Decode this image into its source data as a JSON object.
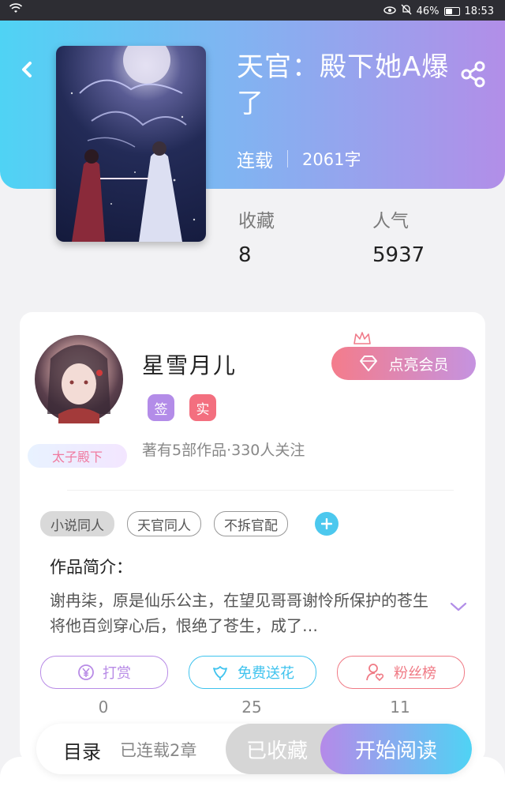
{
  "status_bar": {
    "battery": "46%",
    "battery_level": 0.46,
    "time": "18:53"
  },
  "book": {
    "title": "天官：殿下她A爆了",
    "status": "连载",
    "word_count": "2061字",
    "collect_label": "收藏",
    "collect_value": "8",
    "popularity_label": "人气",
    "popularity_value": "5937"
  },
  "author": {
    "name": "星雪月儿",
    "badges": [
      "签",
      "实"
    ],
    "badge_colors": [
      "#b38ce8",
      "#f36f7f"
    ],
    "title_badge": "太子殿下",
    "stats": "著有5部作品·330人关注",
    "vip_button": "点亮会员"
  },
  "tags": [
    "小说同人",
    "天官同人",
    "不拆官配"
  ],
  "intro": {
    "title": "作品简介：",
    "text": "谢冉柒，原是仙乐公主，在望见哥哥谢怜所保护的苍生将他百剑穿心后，恨绝了苍生，成了…"
  },
  "actions": [
    {
      "label": "打赏",
      "count": "0",
      "color": "#b88be6"
    },
    {
      "label": "免费送花",
      "count": "25",
      "color": "#3fc3ee"
    },
    {
      "label": "粉丝榜",
      "count": "11",
      "color": "#f07a85"
    }
  ],
  "bottom_bar": {
    "toc": "目录",
    "chapters": "已连载2章",
    "collected": "已收藏",
    "start_reading": "开始阅读"
  },
  "colors": {
    "accent_blue": "#4fd3f4",
    "accent_purple": "#b28ee8"
  }
}
